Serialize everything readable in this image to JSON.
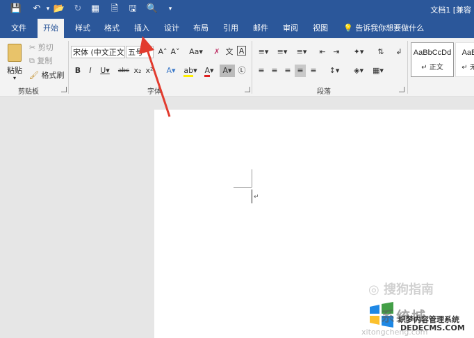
{
  "title_bar": {
    "title": "文档1 [兼容"
  },
  "tabs": [
    "文件",
    "开始",
    "样式",
    "格式",
    "插入",
    "设计",
    "布局",
    "引用",
    "邮件",
    "审阅",
    "视图"
  ],
  "tell_me": "告诉我你想要做什么",
  "clipboard": {
    "paste_label": "粘贴",
    "cut_label": "剪切",
    "copy_label": "复制",
    "format_painter_label": "格式刷",
    "group_label": "剪贴板"
  },
  "font": {
    "font_name": "宋体 (中文正文)",
    "font_size": "五号",
    "group_label": "字体"
  },
  "paragraph": {
    "group_label": "段落"
  },
  "styles": {
    "items": [
      {
        "preview": "AaBbCcDd",
        "name": "正文"
      },
      {
        "preview": "AaB",
        "name": "无"
      }
    ]
  },
  "watermark": {
    "sogou": "搜狗指南",
    "brand": "系统城",
    "line1": "织梦内容管理系统",
    "line2": "DEDECMS.COM",
    "url": "xitongcheng.com"
  }
}
